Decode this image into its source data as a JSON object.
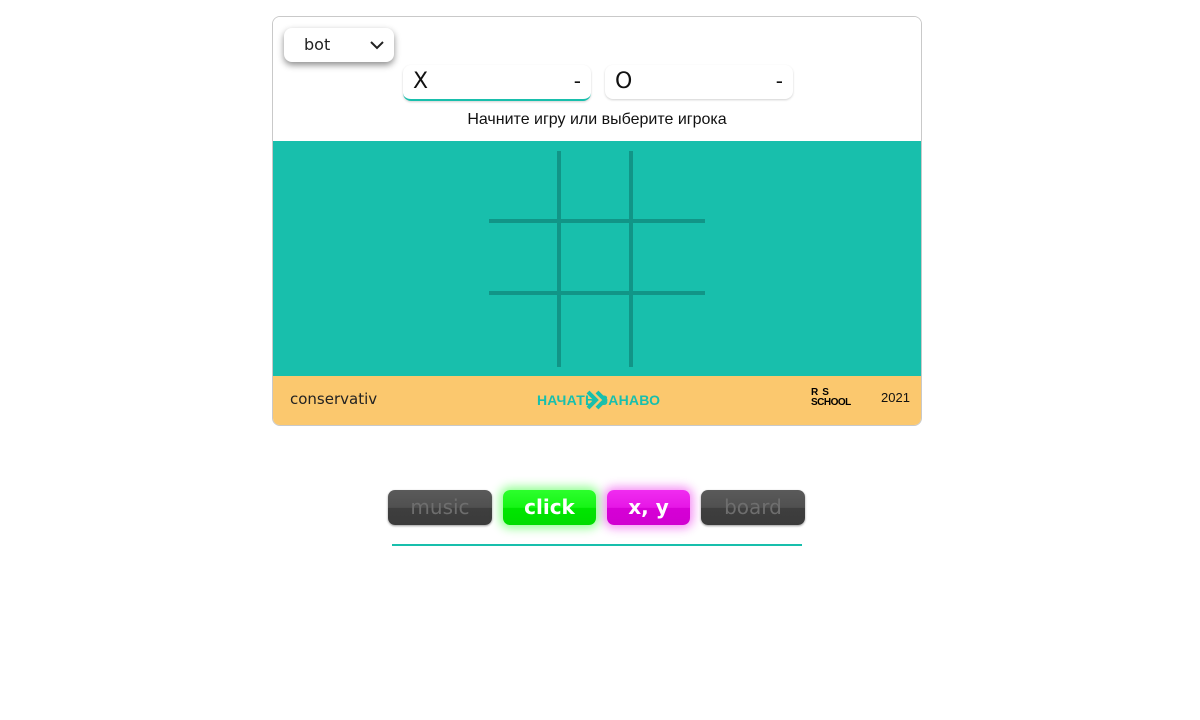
{
  "header": {
    "mode_select": {
      "value": "bot",
      "icon": "chevron-down-icon"
    },
    "players": [
      {
        "mark": "X",
        "score": "-",
        "active": true
      },
      {
        "mark": "O",
        "score": "-",
        "active": false
      }
    ],
    "status": "Начните игру или выберите игрока"
  },
  "board": {
    "cells": [
      "",
      "",
      "",
      "",
      "",
      "",
      "",
      "",
      ""
    ]
  },
  "footer": {
    "difficulty": "conservativ",
    "restart_label": "НАЧАТЬ ЗАНАВО",
    "restart_icon": "double-chevron-right-icon",
    "logo": {
      "line1": "R  S",
      "line2": "SCHOOL"
    },
    "year": "2021"
  },
  "controls": {
    "music": "music",
    "click": "click",
    "xy": "x, y",
    "board": "board"
  },
  "colors": {
    "accent": "#18bfac",
    "board_bg": "#18bfac",
    "grid_lines": "#119587",
    "footer_bg": "#fbc86e",
    "toggle_off": "#4a4a4a",
    "toggle_green": "#00ee00",
    "toggle_magenta": "#e000e0"
  }
}
